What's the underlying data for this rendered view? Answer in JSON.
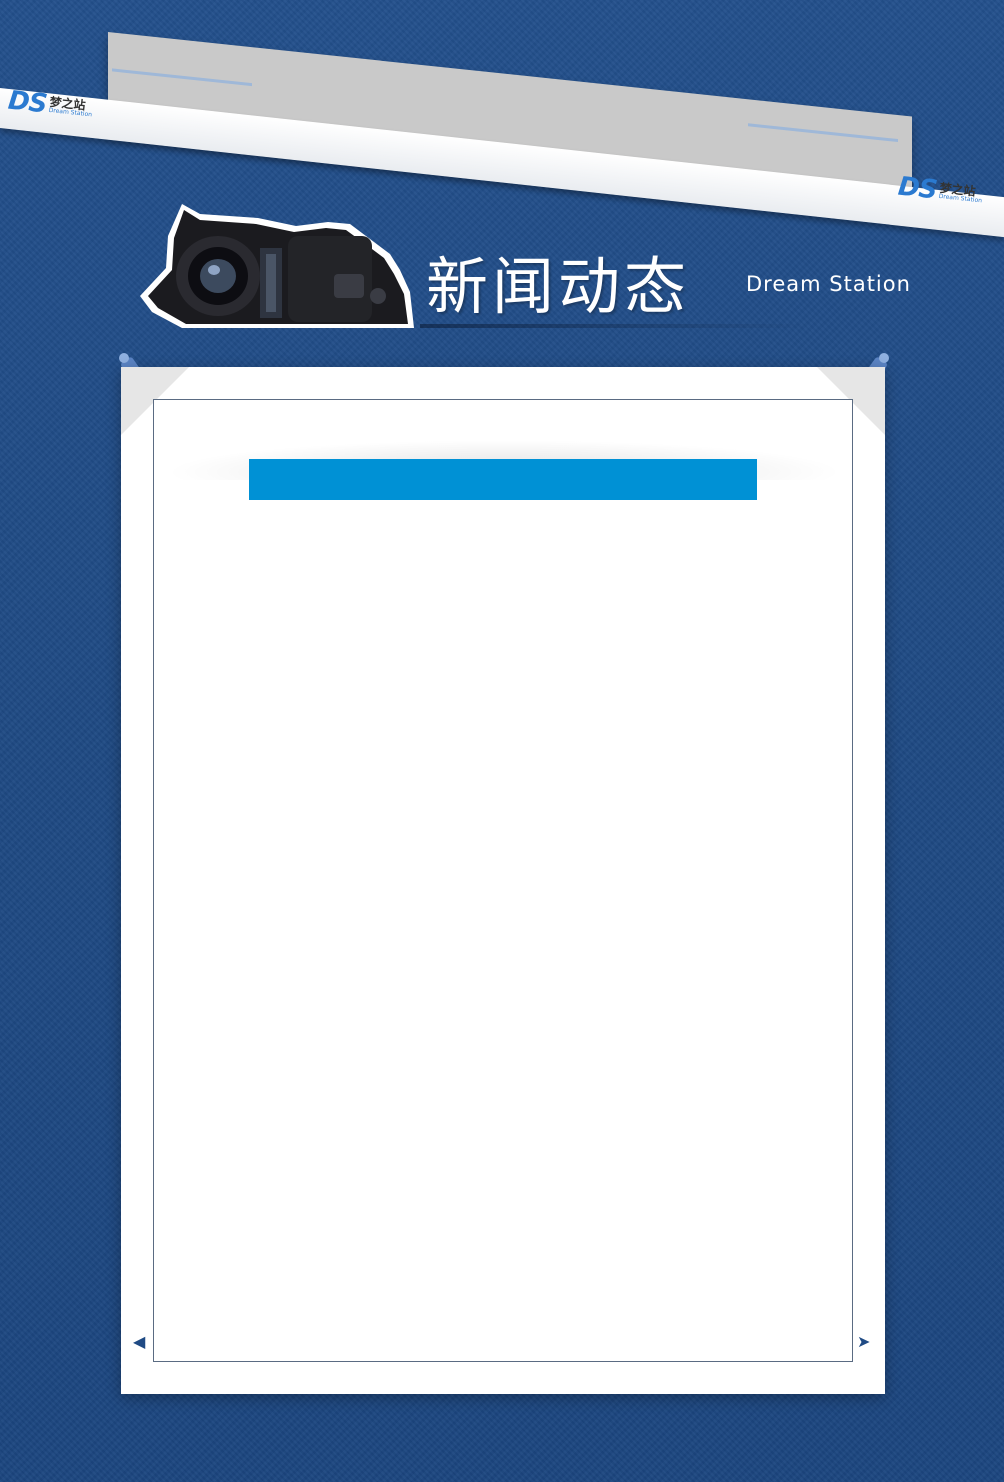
{
  "ribbon": {
    "left_brand": {
      "logo": "DS",
      "name_cn": "梦之站",
      "name_en": "Dream Station"
    },
    "right_brand": {
      "logo": "DS",
      "name_cn": "梦之站",
      "name_en": "Dream Station"
    }
  },
  "header": {
    "title_cn": "新闻动态",
    "title_en": "Dream Station",
    "camera_icon": "camera-icon"
  },
  "board": {
    "title_bar_text": "",
    "pin_icon": "push-pin-icon",
    "prev_icon": "arrow-left-icon",
    "next_icon": "arrow-right-icon"
  },
  "colors": {
    "background": "#1f4a84",
    "title_bar": "#0091d5",
    "board": "#ffffff",
    "brand_blue": "#2b7ad0"
  }
}
